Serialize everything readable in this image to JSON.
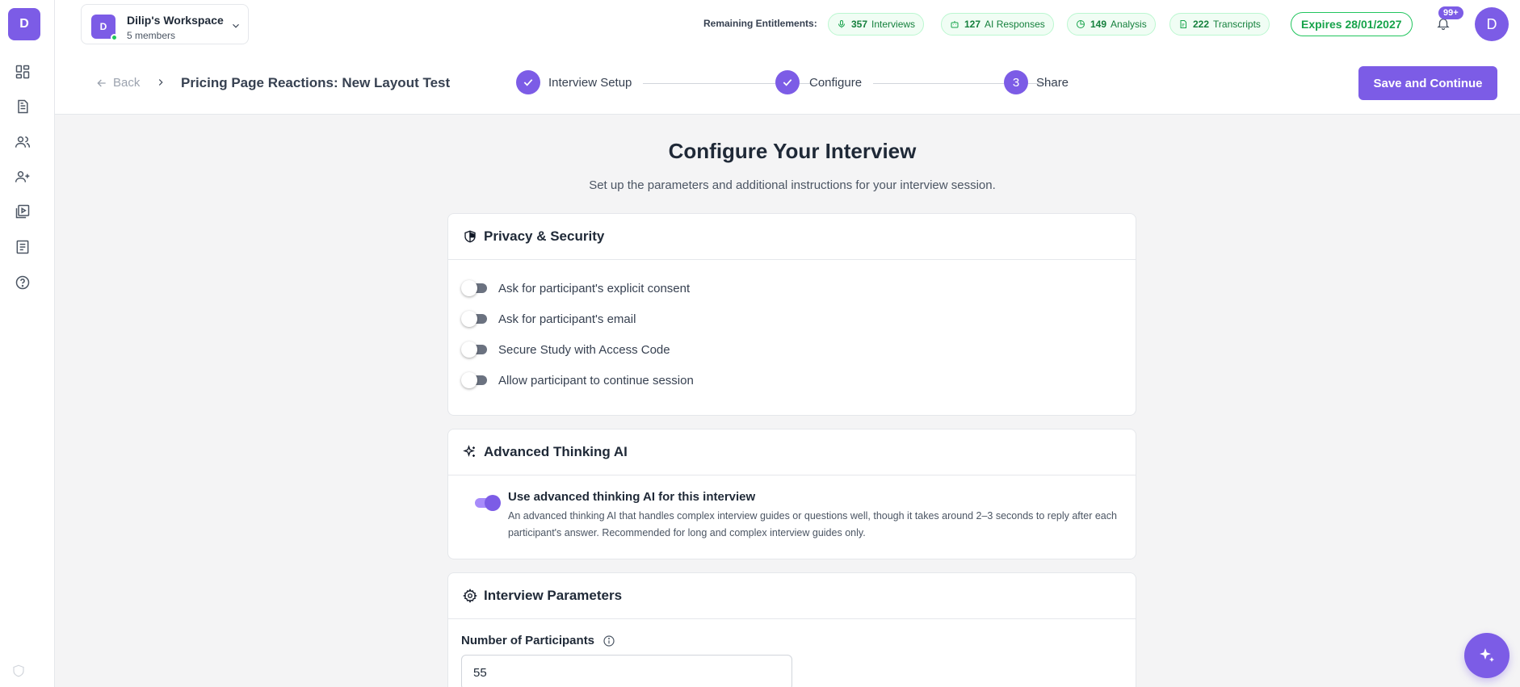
{
  "sidebar": {
    "logo_letter": "D",
    "items": [
      {
        "icon": "dashboard-icon"
      },
      {
        "icon": "document-icon"
      },
      {
        "icon": "users-icon"
      },
      {
        "icon": "add-user-icon"
      },
      {
        "icon": "video-library-icon"
      },
      {
        "icon": "list-icon"
      },
      {
        "icon": "help-icon"
      }
    ],
    "bottom_icon": "shield-icon"
  },
  "workspace": {
    "avatar_letter": "D",
    "name": "Dilip's Workspace",
    "members": "5 members"
  },
  "entitlements": {
    "label": "Remaining Entitlements:",
    "items": [
      {
        "count": "357",
        "label": "Interviews",
        "icon": "mic-icon"
      },
      {
        "count": "127",
        "label": "AI Responses",
        "icon": "robot-icon"
      },
      {
        "count": "149",
        "label": "Analysis",
        "icon": "pie-icon"
      },
      {
        "count": "222",
        "label": "Transcripts",
        "icon": "transcript-icon"
      }
    ],
    "expires": "Expires 28/01/2027"
  },
  "notifications": {
    "badge": "99+"
  },
  "user": {
    "avatar_letter": "D"
  },
  "subheader": {
    "back_label": "Back",
    "study_title": "Pricing Page Reactions: New Layout Test",
    "steps": [
      {
        "label": "Interview Setup",
        "state": "done"
      },
      {
        "label": "Configure",
        "state": "done"
      },
      {
        "label": "Share",
        "number": "3",
        "state": "current"
      }
    ],
    "save_label": "Save and Continue"
  },
  "main": {
    "title": "Configure Your Interview",
    "subtitle": "Set up the parameters and additional instructions for your interview session."
  },
  "privacy": {
    "title": "Privacy & Security",
    "toggles": [
      {
        "label": "Ask for participant's explicit consent",
        "on": false
      },
      {
        "label": "Ask for participant's email",
        "on": false
      },
      {
        "label": "Secure Study with Access Code",
        "on": false
      },
      {
        "label": "Allow participant to continue session",
        "on": false
      }
    ]
  },
  "advanced": {
    "title": "Advanced Thinking AI",
    "toggle_label": "Use advanced thinking AI for this interview",
    "toggle_on": true,
    "description": "An advanced thinking AI that handles complex interview guides or questions well, though it takes around 2–3 seconds to reply after each participant's answer. Recommended for long and complex interview guides only."
  },
  "parameters": {
    "title": "Interview Parameters",
    "participants_label": "Number of Participants",
    "participants_value": "55"
  },
  "colors": {
    "accent": "#7c5ce6",
    "success": "#16a34a"
  }
}
